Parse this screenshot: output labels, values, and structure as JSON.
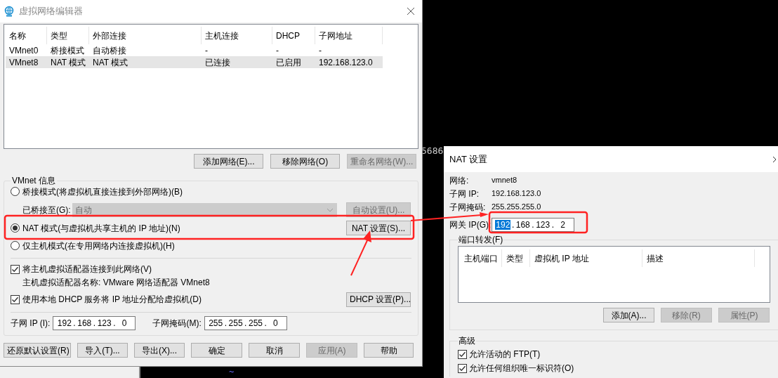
{
  "terminal": {
    "texts": [
      {
        "kind": "fragment",
        "text": "5686"
      },
      {
        "kind": "prompt",
        "text": "~"
      }
    ]
  },
  "editor": {
    "title": "虚拟网络编辑器",
    "table": {
      "columns": [
        "名称",
        "类型",
        "外部连接",
        "主机连接",
        "DHCP",
        "子网地址"
      ],
      "rows": [
        {
          "cells": [
            "VMnet0",
            "桥接模式",
            "自动桥接",
            "-",
            "-",
            "-"
          ],
          "selected": false
        },
        {
          "cells": [
            "VMnet8",
            "NAT 模式",
            "NAT 模式",
            "已连接",
            "已启用",
            "192.168.123.0"
          ],
          "selected": true
        }
      ]
    },
    "list_buttons": [
      {
        "label": "添加网络(E)...",
        "disabled": false
      },
      {
        "label": "移除网络(O)",
        "disabled": false
      },
      {
        "label": "重命名网络(W)...",
        "disabled": true
      }
    ],
    "info": {
      "title": "VMnet 信息",
      "modes": [
        {
          "label": "桥接模式(将虚拟机直接连接到外部网络)(B)",
          "selected": false,
          "sub": {
            "label": "已桥接至(G):",
            "value": "自动",
            "disabled": true,
            "button": {
              "label": "自动设置(U)...",
              "disabled": true
            }
          }
        },
        {
          "label": "NAT 模式(与虚拟机共享主机的 IP 地址)(N)",
          "selected": true,
          "button": {
            "label": "NAT 设置(S)...",
            "disabled": false
          }
        },
        {
          "label": "仅主机模式(在专用网络内连接虚拟机)(H)",
          "selected": false
        }
      ],
      "options": [
        {
          "label": "将主机虚拟适配器连接到此网络(V)",
          "checked": true,
          "note": "主机虚拟适配器名称: VMware 网络适配器 VMnet8"
        },
        {
          "label": "使用本地 DHCP 服务将 IP 地址分配给虚拟机(D)",
          "checked": true,
          "button": {
            "label": "DHCP 设置(P)...",
            "disabled": false
          }
        }
      ],
      "fields": [
        {
          "label": "子网 IP (I):",
          "separator": ".",
          "octets": [
            {
              "text": "192",
              "selected": false
            },
            {
              "text": "168",
              "selected": false
            },
            {
              "text": "123",
              "selected": false
            },
            {
              "text": "0",
              "selected": false
            }
          ]
        },
        {
          "label": "子网掩码(M):",
          "separator": ".",
          "octets": [
            {
              "text": "255",
              "selected": false
            },
            {
              "text": "255",
              "selected": false
            },
            {
              "text": "255",
              "selected": false
            },
            {
              "text": "0",
              "selected": false
            }
          ]
        }
      ]
    },
    "footer_buttons": [
      {
        "label": "还原默认设置(R)",
        "disabled": false
      },
      {
        "label": "导入(T)...",
        "disabled": false
      },
      {
        "label": "导出(X)...",
        "disabled": false
      },
      {
        "label": "确定",
        "disabled": false
      },
      {
        "label": "取消",
        "disabled": false
      },
      {
        "label": "应用(A)",
        "disabled": true
      },
      {
        "label": "帮助",
        "disabled": false
      }
    ]
  },
  "nat": {
    "title": "NAT 设置",
    "info": [
      {
        "label": "网络:",
        "value": "vmnet8"
      },
      {
        "label": "子网 IP:",
        "value": "192.168.123.0"
      },
      {
        "label": "子网掩码:",
        "value": "255.255.255.0"
      }
    ],
    "gateway": {
      "label": "网关 IP(G):",
      "separator": ".",
      "octets": [
        {
          "text": "192",
          "selected": true
        },
        {
          "text": "168",
          "selected": false
        },
        {
          "text": "123",
          "selected": false
        },
        {
          "text": "2",
          "selected": false
        }
      ]
    },
    "port_forwarding": {
      "title": "端口转发(F)",
      "columns": [
        "主机端口",
        "类型",
        "虚拟机 IP 地址",
        "描述"
      ],
      "buttons": [
        {
          "label": "添加(A)...",
          "disabled": false
        },
        {
          "label": "移除(R)",
          "disabled": true
        },
        {
          "label": "属性(P)",
          "disabled": true
        }
      ]
    },
    "advanced": {
      "title": "高级",
      "options": [
        {
          "label": "允许活动的 FTP(T)",
          "checked": true
        },
        {
          "label": "允许任何组织唯一标识符(O)",
          "checked": true
        }
      ]
    }
  }
}
